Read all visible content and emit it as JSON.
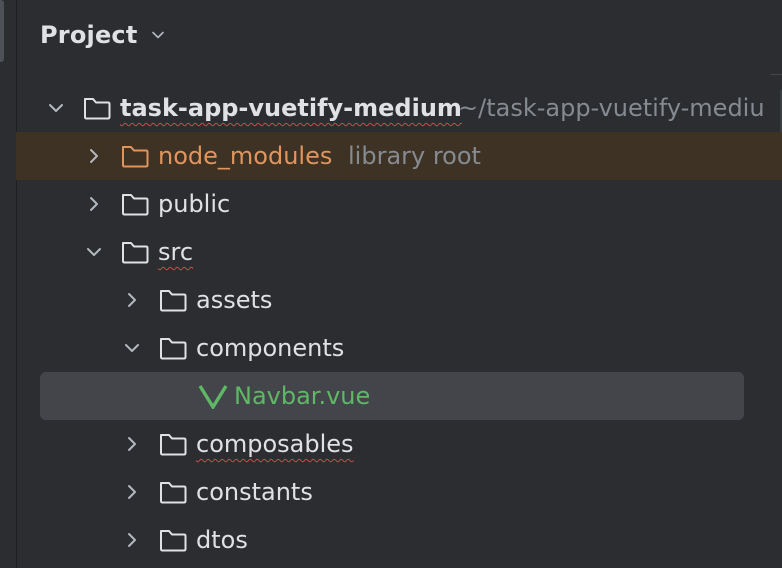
{
  "header": {
    "title": "Project",
    "dropdown_icon": "chevron-down-icon"
  },
  "tree": {
    "root": {
      "name": "task-app-vuetify-medium",
      "path": "~/task-app-vuetify-mediu",
      "expanded": true
    },
    "node_modules": {
      "name": "node_modules",
      "note": "library root",
      "expanded": false
    },
    "public": {
      "name": "public",
      "expanded": false
    },
    "src": {
      "name": "src",
      "expanded": true,
      "assets": {
        "name": "assets",
        "expanded": false
      },
      "components": {
        "name": "components",
        "expanded": true,
        "navbar": {
          "name": "Navbar.vue",
          "icon": "vue-icon",
          "selected": true
        }
      },
      "composables": {
        "name": "composables",
        "expanded": false
      },
      "constants": {
        "name": "constants",
        "expanded": false
      },
      "dtos": {
        "name": "dtos",
        "expanded": false
      }
    }
  },
  "colors": {
    "panel_bg": "#2b2d30",
    "library_root_bg": "#3d3223",
    "selection_bg": "#43454a",
    "node_modules_text": "#e0955e",
    "vue_file_text": "#5fb865",
    "secondary_text": "#868a91",
    "spelling_squiggle": "#d0484a"
  }
}
